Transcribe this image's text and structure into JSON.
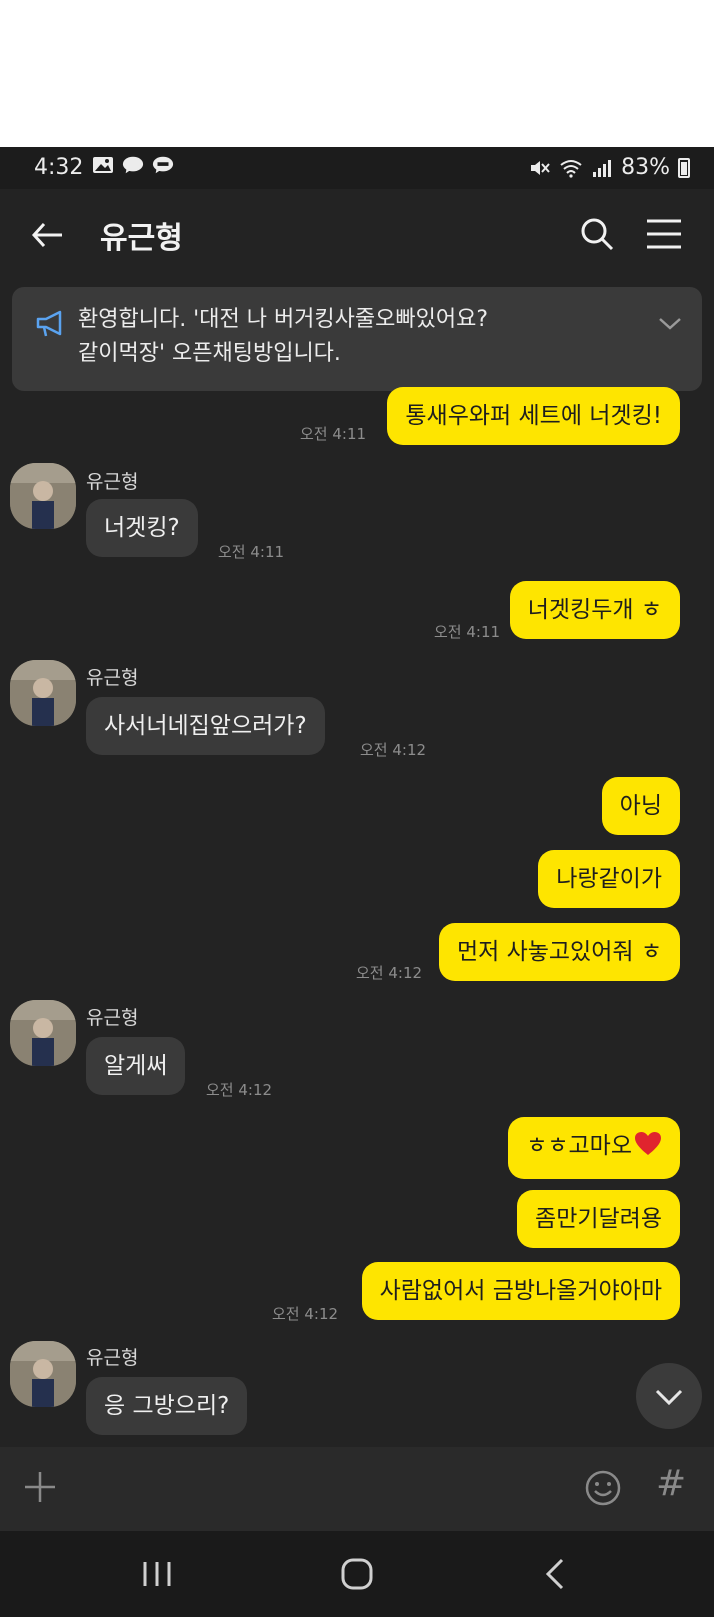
{
  "status_bar": {
    "time": "4:32",
    "battery": "83%",
    "left_icons": [
      "image-icon",
      "chat-bubble-icon",
      "talk-icon"
    ],
    "right_icons": [
      "mute-icon",
      "wifi-icon",
      "signal-icon",
      "battery-icon"
    ]
  },
  "header": {
    "title": "유근형",
    "icons": [
      "back-arrow-icon",
      "search-icon",
      "menu-icon"
    ]
  },
  "notice": {
    "line1": "환영합니다. '대전 나 버거킹사줄오빠있어요?",
    "line2": "같이먹장' 오픈채팅방입니다."
  },
  "messages": {
    "m1": {
      "text": "통새우와퍼 세트에 너겟킹!",
      "time": "오전 4:11"
    },
    "m2": {
      "sender": "유근형",
      "text": "너겟킹?",
      "time": "오전 4:11"
    },
    "m3": {
      "text": "너겟킹두개 ㅎ",
      "time": "오전 4:11"
    },
    "m4": {
      "sender": "유근형",
      "text": "사서너네집앞으러가?",
      "time": "오전 4:12"
    },
    "m5": {
      "text": "아닝"
    },
    "m6": {
      "text": "나랑같이가"
    },
    "m7": {
      "text": "먼저 사놓고있어줘 ㅎ",
      "time": "오전 4:12"
    },
    "m8": {
      "sender": "유근형",
      "text": "알게써",
      "time": "오전 4:12"
    },
    "m9": {
      "text": "ㅎㅎ고마오"
    },
    "m10": {
      "text": "좀만기달려용"
    },
    "m11": {
      "text": "사람없어서 금방나올거야아마",
      "time": "오전 4:12"
    },
    "m12": {
      "sender": "유근형",
      "text": "응 그방으리?"
    }
  },
  "input_bar": {
    "hash": "#",
    "icons": [
      "plus-icon",
      "emoji-icon"
    ]
  },
  "colors": {
    "background": "#232323",
    "my_bubble": "#fee500",
    "their_bubble": "#3a3a3a",
    "heart": "#e0242e"
  }
}
